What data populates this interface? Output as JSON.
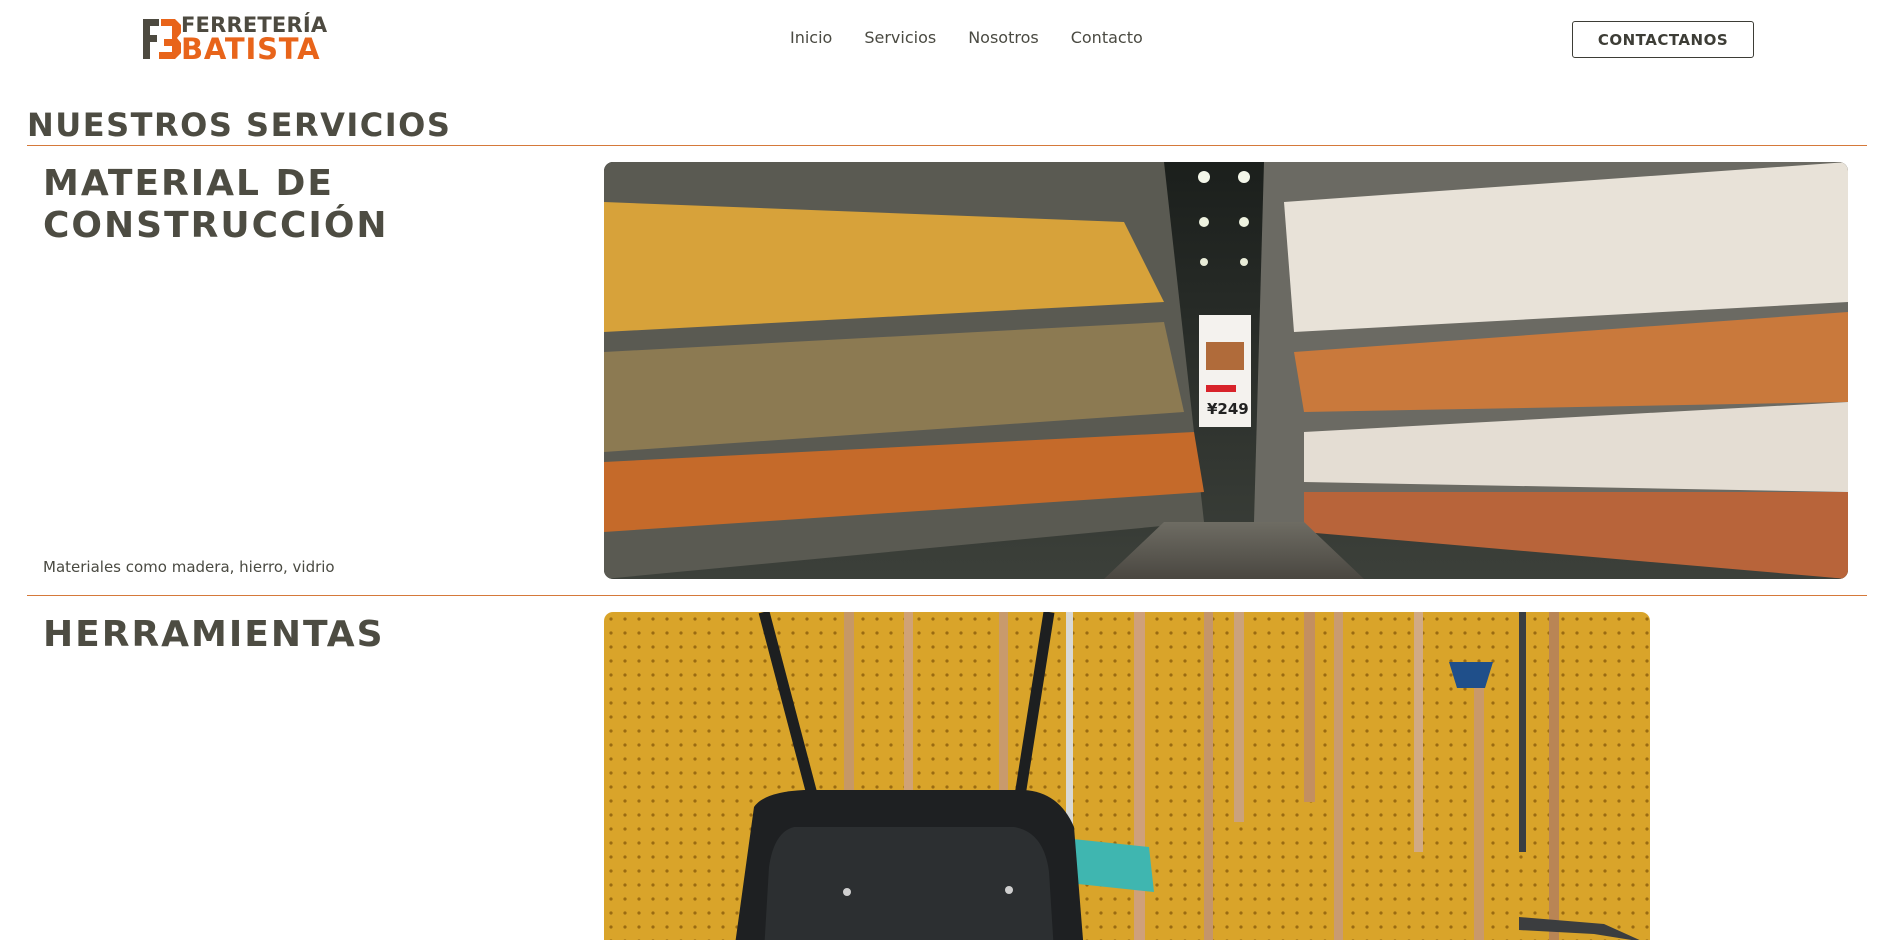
{
  "header": {
    "logo": {
      "line1": "FERRETERÍA",
      "line2": "BATISTA"
    },
    "nav": [
      {
        "label": "Inicio"
      },
      {
        "label": "Servicios"
      },
      {
        "label": "Nosotros"
      },
      {
        "label": "Contacto"
      }
    ],
    "cta_label": "CONTACTANOS"
  },
  "main": {
    "title": "NUESTROS SERVICIOS",
    "services": [
      {
        "name_line1": "MATERIAL DE",
        "name_line2": "CONSTRUCCIÓN",
        "description": "Materiales como madera, hierro, vidrio",
        "image": "warehouse-aisle-photo"
      },
      {
        "name_line1": "HERRAMIENTAS",
        "image": "tools-wall-photo"
      }
    ]
  },
  "colors": {
    "accent": "#e8641a",
    "text": "#4d4c42",
    "rule": "#d5793a"
  }
}
